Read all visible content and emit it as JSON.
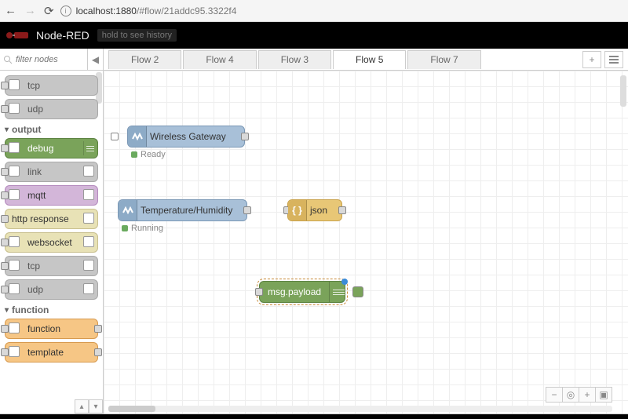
{
  "browser": {
    "url_host": "localhost:",
    "url_port": "1880",
    "url_path": "/#flow/21addc95.3322f4"
  },
  "header": {
    "title": "Node-RED",
    "history_hint": "hold to see history"
  },
  "palette": {
    "search_placeholder": "filter nodes",
    "categories": {
      "output": "output",
      "function": "function"
    },
    "nodes": {
      "tcp_in": "tcp",
      "udp_in": "udp",
      "debug": "debug",
      "link": "link",
      "mqtt": "mqtt",
      "http_response": "http response",
      "websocket": "websocket",
      "tcp_out": "tcp",
      "udp_out": "udp",
      "function": "function",
      "template": "template"
    }
  },
  "tabs": [
    "Flow 2",
    "Flow 4",
    "Flow 3",
    "Flow 5",
    "Flow 7"
  ],
  "active_tab": 3,
  "canvas_nodes": {
    "gateway": {
      "label": "Wireless Gateway",
      "status": "Ready"
    },
    "temp": {
      "label": "Temperature/Humidity",
      "status": "Running"
    },
    "json": {
      "label": "json"
    },
    "debug": {
      "label": "msg.payload"
    }
  }
}
